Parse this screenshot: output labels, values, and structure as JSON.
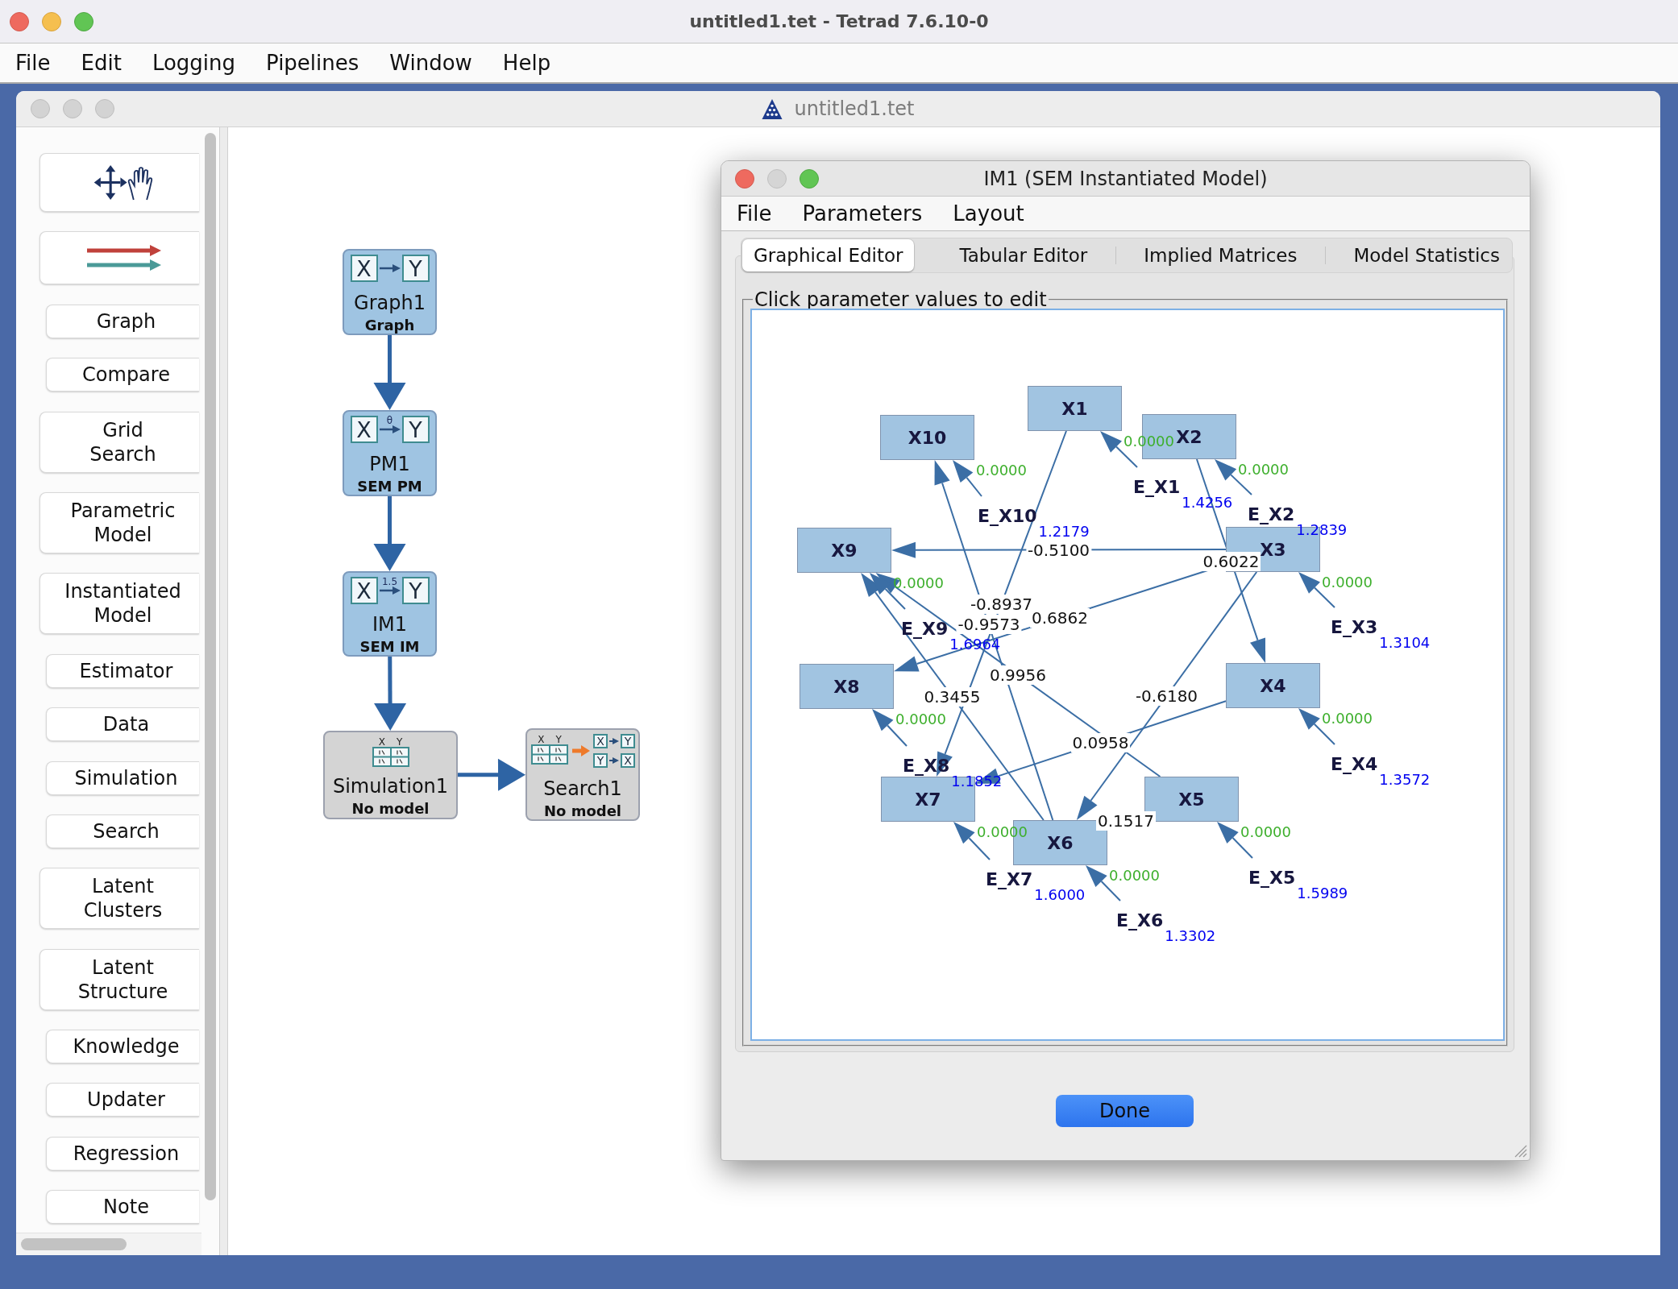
{
  "window": {
    "title": "untitled1.tet - Tetrad 7.6.10-0"
  },
  "menu_bar": [
    "File",
    "Edit",
    "Logging",
    "Pipelines",
    "Window",
    "Help"
  ],
  "session_window": {
    "title": "untitled1.tet",
    "toolbox": {
      "tools": [
        {
          "kind": "move"
        },
        {
          "kind": "connect"
        }
      ],
      "buttons": [
        "Graph",
        "Compare",
        "Grid Search",
        "Parametric Model",
        "Instantiated Model",
        "Estimator",
        "Data",
        "Simulation",
        "Search",
        "Latent Clusters",
        "Latent Structure",
        "Knowledge",
        "Updater",
        "Regression",
        "Note"
      ]
    },
    "session_nodes": [
      {
        "name": "Graph1",
        "type": "Graph",
        "kind": "graph",
        "has_model": true,
        "icon_text": [
          "X",
          "Y"
        ],
        "children": [
          {
            "name": "PM1",
            "type": "SEM PM",
            "kind": "pm",
            "has_model": true,
            "icon_text": [
              "X",
              "Y"
            ],
            "arrow_text": "θ",
            "children": [
              {
                "name": "IM1",
                "type": "SEM IM",
                "kind": "im",
                "has_model": true,
                "icon_text": [
                  "X",
                  "Y"
                ],
                "arrow_text": "1.5",
                "children": [
                  {
                    "name": "Simulation1",
                    "type": "No model",
                    "kind": "simulation",
                    "has_model": false,
                    "icon_text": [
                      "X",
                      "Y"
                    ],
                    "children": [
                      {
                        "name": "Search1",
                        "type": "No model",
                        "kind": "search",
                        "has_model": false,
                        "icon_text": [
                          "X",
                          "Y"
                        ],
                        "graph_text": [
                          "X",
                          "Y",
                          "Y",
                          "X"
                        ]
                      }
                    ]
                  }
                ]
              }
            ]
          }
        ]
      }
    ]
  },
  "dialog": {
    "title": "IM1 (SEM Instantiated Model)",
    "menu_bar": [
      "File",
      "Parameters",
      "Layout"
    ],
    "tabs": [
      {
        "label": "Graphical Editor",
        "selected": true
      },
      {
        "label": "Tabular Editor",
        "selected": false
      },
      {
        "label": "Implied Matrices",
        "selected": false
      },
      {
        "label": "Model Statistics",
        "selected": false
      }
    ],
    "panel": {
      "title": "Click parameter values to edit",
      "graph": {
        "nodes": [
          {
            "name": "X1",
            "error": {
              "name": "E_X1",
              "coefficient": "0.0000",
              "variance": "1.4256"
            }
          },
          {
            "name": "X10",
            "error": {
              "name": "E_X10",
              "coefficient": "0.0000",
              "variance": "1.2179"
            }
          },
          {
            "name": "X2",
            "error": {
              "name": "E_X2",
              "coefficient": "0.0000",
              "variance": "1.2839"
            }
          },
          {
            "name": "X9",
            "error": {
              "name": "E_X9",
              "coefficient": "0.0000",
              "variance": "1.6964"
            }
          },
          {
            "name": "X3",
            "error": {
              "name": "E_X3",
              "coefficient": "0.0000",
              "variance": "1.3104"
            }
          },
          {
            "name": "X8",
            "error": {
              "name": "E_X8",
              "coefficient": "0.0000",
              "variance": "1.1852"
            }
          },
          {
            "name": "X4",
            "error": {
              "name": "E_X4",
              "coefficient": "0.0000",
              "variance": "1.3572"
            }
          },
          {
            "name": "X7",
            "error": {
              "name": "E_X7",
              "coefficient": "0.0000",
              "variance": "1.6000"
            }
          },
          {
            "name": "X5",
            "error": {
              "name": "E_X5",
              "coefficient": "0.0000",
              "variance": "1.5989"
            }
          },
          {
            "name": "X6",
            "error": {
              "name": "E_X6",
              "coefficient": "0.0000",
              "variance": "1.3302"
            }
          }
        ],
        "edges": [
          {
            "coefficient": "-0.5100"
          },
          {
            "coefficient": "0.6022"
          },
          {
            "coefficient": "-0.8937"
          },
          {
            "coefficient": "0.6862"
          },
          {
            "coefficient": "-0.9573"
          },
          {
            "coefficient": "0.9956"
          },
          {
            "coefficient": "0.3455"
          },
          {
            "coefficient": "-0.6180"
          },
          {
            "coefficient": "0.0958"
          },
          {
            "coefficient": "0.1517"
          }
        ]
      }
    },
    "buttons": [
      "Done"
    ]
  }
}
